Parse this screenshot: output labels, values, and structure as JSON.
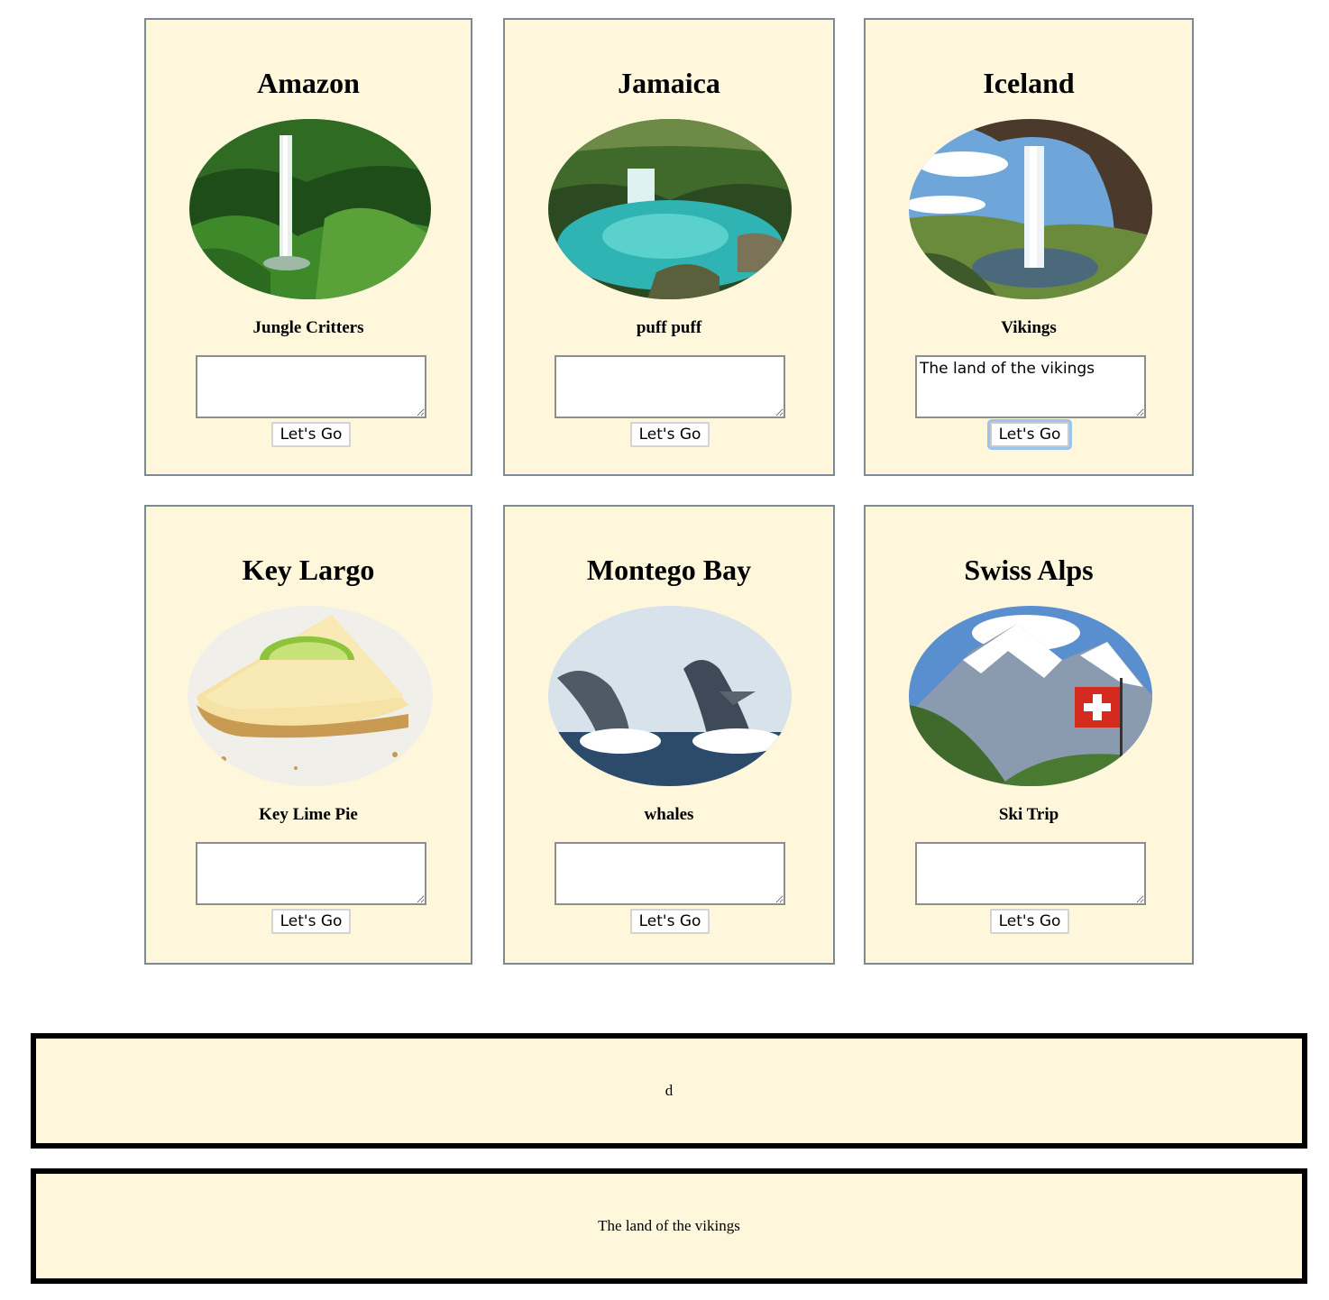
{
  "cards": [
    {
      "title": "Amazon",
      "image": "waterfall-jungle-photo",
      "caption": "Jungle Critters",
      "textarea_value": "",
      "button_label": "Let's Go"
    },
    {
      "title": "Jamaica",
      "image": "turquoise-waterfall-pool-photo",
      "caption": "puff puff",
      "textarea_value": "",
      "button_label": "Let's Go"
    },
    {
      "title": "Iceland",
      "image": "cave-waterfall-photo",
      "caption": "Vikings",
      "textarea_value": "The land of the vikings",
      "button_label": "Let's Go"
    },
    {
      "title": "Key Largo",
      "image": "key-lime-pie-photo",
      "caption": "Key Lime Pie",
      "textarea_value": "",
      "button_label": "Let's Go"
    },
    {
      "title": "Montego Bay",
      "image": "breaching-whales-photo",
      "caption": "whales",
      "textarea_value": "",
      "button_label": "Let's Go"
    },
    {
      "title": "Swiss Alps",
      "image": "snowy-mountains-swiss-flag-photo",
      "caption": "Ski Trip",
      "textarea_value": "",
      "button_label": "Let's Go"
    }
  ],
  "outputs": [
    {
      "text": "d"
    },
    {
      "text": "The land of the vikings"
    }
  ],
  "colors": {
    "card_background": "#fef7dc",
    "card_border": "#7c8a94",
    "output_border": "#000000",
    "focus_ring": "#9cc3ea"
  }
}
